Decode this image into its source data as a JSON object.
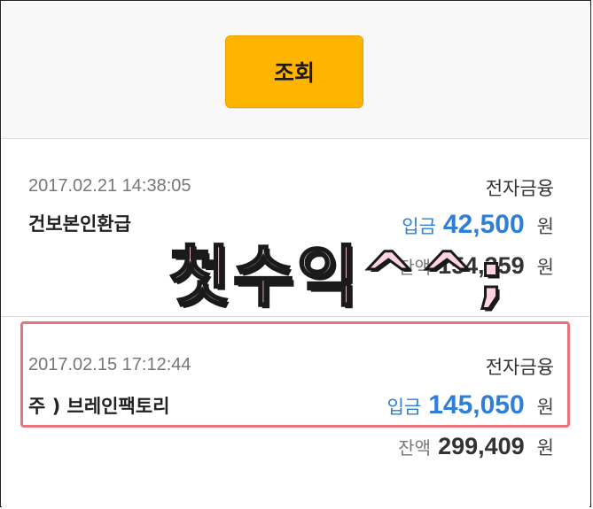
{
  "header": {
    "search_button_label": "조회"
  },
  "transactions": [
    {
      "datetime": "2017.02.21 14:38:05",
      "category": "전자금융",
      "description": "건보본인환급",
      "amount_label": "입금",
      "amount": "42,500",
      "amount_unit": "원",
      "balance_label": "잔액",
      "balance": "154,359",
      "balance_unit": "원"
    },
    {
      "datetime": "2017.02.15 17:12:44",
      "category": "전자금융",
      "description": "주 ) 브레인팩토리",
      "amount_label": "입금",
      "amount": "145,050",
      "amount_unit": "원",
      "balance_label": "잔액",
      "balance": "299,409",
      "balance_unit": "원"
    }
  ],
  "overlay_caption": "첫수익^^;",
  "colors": {
    "button": "#ffb400",
    "amount": "#2f7fd8",
    "highlight_border": "#e8737b",
    "overlay_fill": "#ffd3e4"
  }
}
